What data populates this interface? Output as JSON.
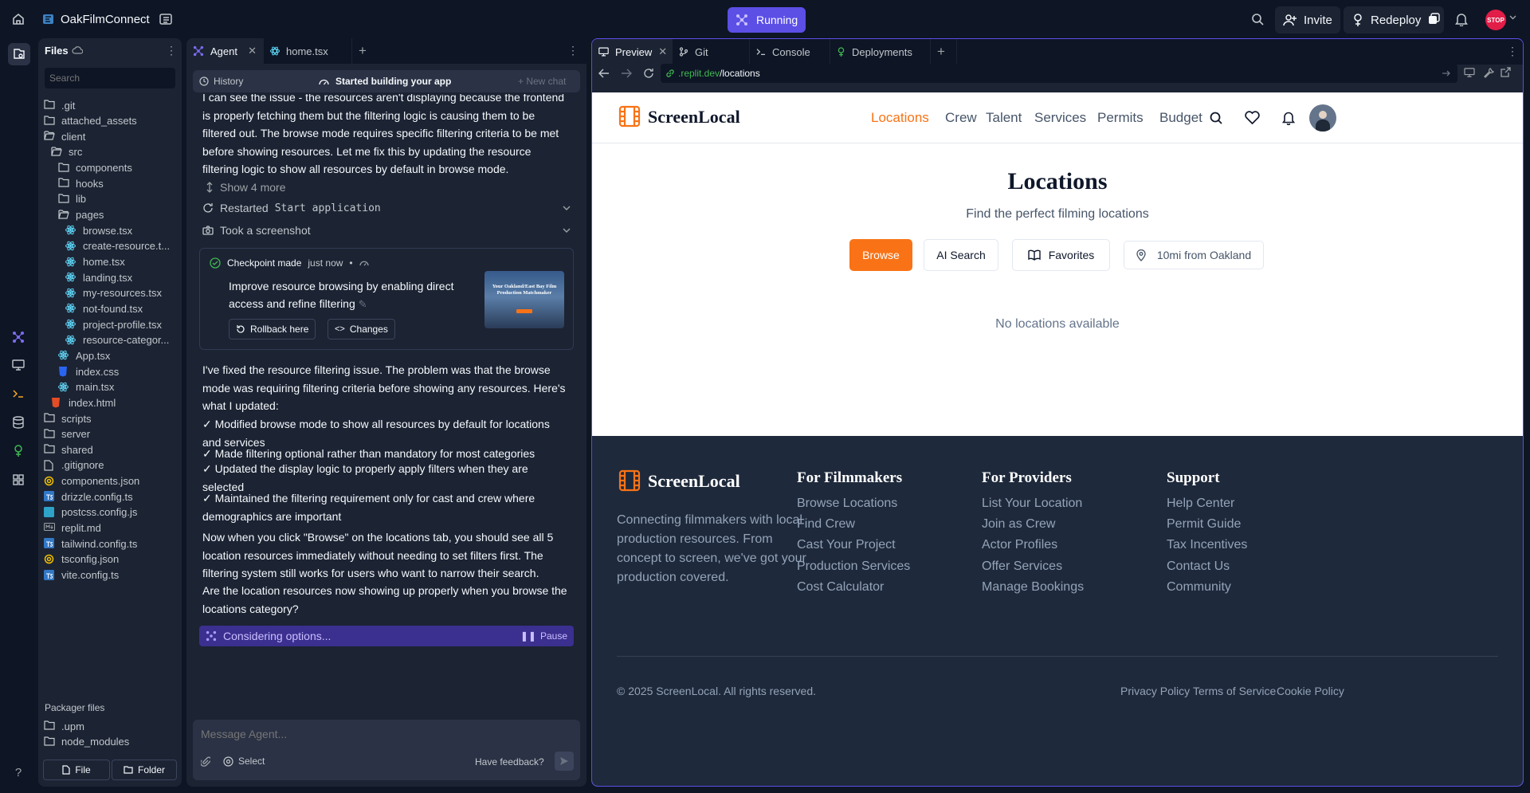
{
  "topbar": {
    "project_name": "OakFilmConnect",
    "run_status": "Running",
    "invite_label": "Invite",
    "redeploy_label": "Redeploy",
    "stop_label": "STOP"
  },
  "files_panel": {
    "title": "Files",
    "search_placeholder": "Search",
    "tree": [
      {
        "name": ".git",
        "type": "folder",
        "depth": 0
      },
      {
        "name": "attached_assets",
        "type": "folder",
        "depth": 0
      },
      {
        "name": "client",
        "type": "folder-open",
        "depth": 0
      },
      {
        "name": "src",
        "type": "folder-open",
        "depth": 1
      },
      {
        "name": "components",
        "type": "folder",
        "depth": 2
      },
      {
        "name": "hooks",
        "type": "folder",
        "depth": 2
      },
      {
        "name": "lib",
        "type": "folder",
        "depth": 2
      },
      {
        "name": "pages",
        "type": "folder-open",
        "depth": 2
      },
      {
        "name": "browse.tsx",
        "type": "react",
        "depth": 3
      },
      {
        "name": "create-resource.t...",
        "type": "react",
        "depth": 3
      },
      {
        "name": "home.tsx",
        "type": "react",
        "depth": 3
      },
      {
        "name": "landing.tsx",
        "type": "react",
        "depth": 3
      },
      {
        "name": "my-resources.tsx",
        "type": "react",
        "depth": 3
      },
      {
        "name": "not-found.tsx",
        "type": "react",
        "depth": 3
      },
      {
        "name": "project-profile.tsx",
        "type": "react",
        "depth": 3
      },
      {
        "name": "resource-categor...",
        "type": "react",
        "depth": 3
      },
      {
        "name": "App.tsx",
        "type": "react",
        "depth": 2
      },
      {
        "name": "index.css",
        "type": "css",
        "depth": 2
      },
      {
        "name": "main.tsx",
        "type": "react",
        "depth": 2
      },
      {
        "name": "index.html",
        "type": "html",
        "depth": 1
      },
      {
        "name": "scripts",
        "type": "folder",
        "depth": 0
      },
      {
        "name": "server",
        "type": "folder",
        "depth": 0
      },
      {
        "name": "shared",
        "type": "folder",
        "depth": 0
      },
      {
        "name": ".gitignore",
        "type": "file",
        "depth": 0
      },
      {
        "name": "components.json",
        "type": "json",
        "depth": 0
      },
      {
        "name": "drizzle.config.ts",
        "type": "ts",
        "depth": 0
      },
      {
        "name": "postcss.config.js",
        "type": "js",
        "depth": 0
      },
      {
        "name": "replit.md",
        "type": "md",
        "depth": 0
      },
      {
        "name": "tailwind.config.ts",
        "type": "ts",
        "depth": 0
      },
      {
        "name": "tsconfig.json",
        "type": "json",
        "depth": 0
      },
      {
        "name": "vite.config.ts",
        "type": "ts",
        "depth": 0
      }
    ],
    "packager_title": "Packager files",
    "packager": [
      {
        "name": ".upm",
        "type": "folder",
        "depth": 0
      },
      {
        "name": "node_modules",
        "type": "folder",
        "depth": 0
      }
    ],
    "new_file_label": "File",
    "new_folder_label": "Folder"
  },
  "agent_panel": {
    "tabs": [
      {
        "label": "Agent"
      },
      {
        "label": "home.tsx"
      }
    ],
    "history_label": "History",
    "status_title": "Started building your app",
    "new_chat_label": "New chat",
    "intro_text": "I can see the issue - the resources aren't displaying because the frontend is properly fetching them but the filtering logic is causing them to be filtered out. The browse mode requires specific filtering criteria to be met before showing resources. Let me fix this by updating the resource filtering logic to show all resources by default in browse mode.",
    "show_more": "Show 4 more",
    "action_restarted_prefix": "Restarted",
    "action_restarted_code": "Start application",
    "action_screenshot": "Took a screenshot",
    "checkpoint": {
      "prefix": "Checkpoint made",
      "time": "just now",
      "title": "Improve resource browsing by enabling direct access and refine filtering",
      "rollback_label": "Rollback here",
      "changes_label": "Changes",
      "thumb_text": "Your Oakland/East Bay Film Production Matchmaker"
    },
    "reply_p1": "I've fixed the resource filtering issue. The problem was that the browse mode was requiring filtering criteria before showing any resources. Here's what I updated:",
    "reply_list": [
      "✓ Modified browse mode to show all resources by default for locations and services",
      "✓ Made filtering optional rather than mandatory for most categories",
      "✓ Updated the display logic to properly apply filters when they are selected",
      "✓ Maintained the filtering requirement only for cast and crew where demographics are important"
    ],
    "reply_p2": "Now when you click \"Browse\" on the locations tab, you should see all 5 location resources immediately without needing to set filters first. The filtering system still works for users who want to narrow their search.",
    "reply_p3": "Are the location resources now showing up properly when you browse the locations category?",
    "considering_label": "Considering options...",
    "pause_label": "Pause",
    "input_placeholder": "Message Agent...",
    "select_label": "Select",
    "feedback_label": "Have feedback?"
  },
  "preview_panel": {
    "tabs": [
      {
        "label": "Preview"
      },
      {
        "label": "Git"
      },
      {
        "label": "Console"
      },
      {
        "label": "Deployments"
      }
    ],
    "url_domain": ".replit.dev",
    "url_path": "/locations"
  },
  "site": {
    "brand": "ScreenLocal",
    "nav": [
      "Locations",
      "Crew",
      "Talent",
      "Services",
      "Permits",
      "Budget"
    ],
    "page_title": "Locations",
    "page_subtitle": "Find the perfect filming locations",
    "browse_label": "Browse",
    "ai_search_label": "AI Search",
    "favorites_label": "Favorites",
    "location_filter_label": "10mi from Oakland",
    "empty_message": "No locations available",
    "footer": {
      "tagline": "Connecting filmmakers with local production resources. From concept to screen, we've got your production covered.",
      "columns": [
        {
          "title": "For Filmmakers",
          "links": [
            "Browse Locations",
            "Find Crew",
            "Cast Your Project",
            "Production Services",
            "Cost Calculator"
          ]
        },
        {
          "title": "For Providers",
          "links": [
            "List Your Location",
            "Join as Crew",
            "Actor Profiles",
            "Offer Services",
            "Manage Bookings"
          ]
        },
        {
          "title": "Support",
          "links": [
            "Help Center",
            "Permit Guide",
            "Tax Incentives",
            "Contact Us",
            "Community"
          ]
        }
      ],
      "copyright": "© 2025 ScreenLocal. All rights reserved.",
      "legal": [
        "Privacy Policy",
        "Terms of Service",
        "Cookie Policy"
      ]
    }
  },
  "colors": {
    "accent_orange": "#f97316",
    "replit_purple": "#5b4fe6",
    "ide_bg": "#0e1525",
    "panel_bg": "#1c2333"
  }
}
